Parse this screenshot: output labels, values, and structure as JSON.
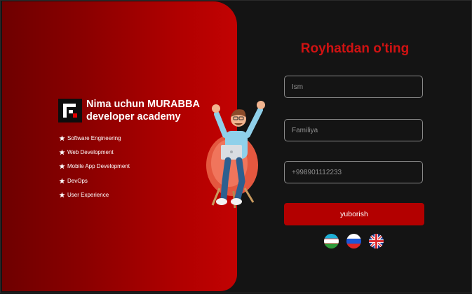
{
  "brand": {
    "title_line1": "Nima uchun MURABBA",
    "title_line2": "developer academy",
    "logo_icon": "murabba-logo-icon"
  },
  "features": [
    {
      "label": "Software Engineering",
      "icon": "star-icon"
    },
    {
      "label": "Web Development",
      "icon": "star-icon"
    },
    {
      "label": "Mobile App Development",
      "icon": "star-icon"
    },
    {
      "label": "DevOps",
      "icon": "star-icon"
    },
    {
      "label": "User Experience",
      "icon": "star-icon"
    }
  ],
  "form": {
    "title": "Royhatdan o'ting",
    "first_name": {
      "value": "",
      "placeholder": "Ism"
    },
    "last_name": {
      "value": "",
      "placeholder": "Familiya"
    },
    "phone": {
      "value": "",
      "placeholder": "+998901112233"
    },
    "submit_label": "yuborish"
  },
  "languages": [
    {
      "code": "uz",
      "icon": "uzbekistan-flag-icon"
    },
    {
      "code": "ru",
      "icon": "russia-flag-icon"
    },
    {
      "code": "en",
      "icon": "uk-flag-icon"
    }
  ],
  "colors": {
    "accent": "#b30000",
    "title": "#d01212",
    "background": "#141414"
  }
}
